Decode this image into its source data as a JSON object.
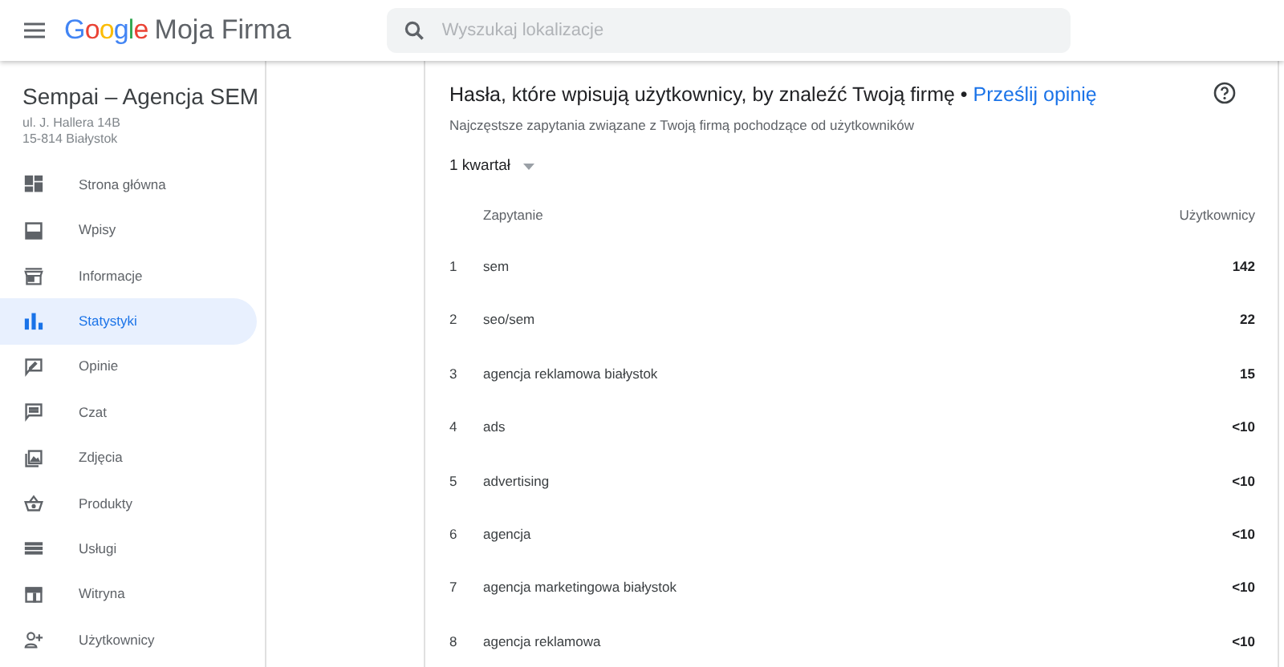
{
  "header": {
    "logo": "Google",
    "product": "Moja Firma",
    "search": {
      "placeholder": "Wyszukaj lokalizacje"
    }
  },
  "sidebar": {
    "business_name": "Sempai – Agencja SEM",
    "address": [
      "ul. J. Hallera 14B",
      "15-814 Białystok"
    ],
    "items": [
      {
        "label": "Strona główna",
        "kind": "dashboard",
        "selected": false
      },
      {
        "label": "Wpisy",
        "kind": "posts",
        "selected": false
      },
      {
        "label": "Informacje",
        "kind": "store",
        "selected": false
      },
      {
        "label": "Statystyki",
        "kind": "chart",
        "selected": true
      },
      {
        "label": "Opinie",
        "kind": "review",
        "selected": false
      },
      {
        "label": "Czat",
        "kind": "chat",
        "selected": false
      },
      {
        "label": "Zdjęcia",
        "kind": "photos",
        "selected": false
      },
      {
        "label": "Produkty",
        "kind": "basket",
        "selected": false
      },
      {
        "label": "Usługi",
        "kind": "list",
        "selected": false
      },
      {
        "label": "Witryna",
        "kind": "web",
        "selected": false
      },
      {
        "label": "Użytkownicy",
        "kind": "adduser",
        "selected": false
      }
    ]
  },
  "card": {
    "title": "Hasła, które wpisują użytkownicy, by znaleźć Twoją firmę • ",
    "link": "Prześlij opinię",
    "subtitle": "Najczęstsze zapytania związane z Twoją firmą pochodzące od użytkowników",
    "period": "1 kwartał",
    "table": {
      "columns": [
        "Zapytanie",
        "Użytkownicy"
      ],
      "rows": [
        {
          "rank": "1",
          "query": "sem",
          "users": "142"
        },
        {
          "rank": "2",
          "query": "seo/sem",
          "users": "22"
        },
        {
          "rank": "3",
          "query": "agencja reklamowa białystok",
          "users": "15"
        },
        {
          "rank": "4",
          "query": "ads",
          "users": "<10"
        },
        {
          "rank": "5",
          "query": "advertising",
          "users": "<10"
        },
        {
          "rank": "6",
          "query": "agencja",
          "users": "<10"
        },
        {
          "rank": "7",
          "query": "agencja marketingowa białystok",
          "users": "<10"
        },
        {
          "rank": "8",
          "query": "agencja reklamowa",
          "users": "<10"
        }
      ]
    }
  }
}
